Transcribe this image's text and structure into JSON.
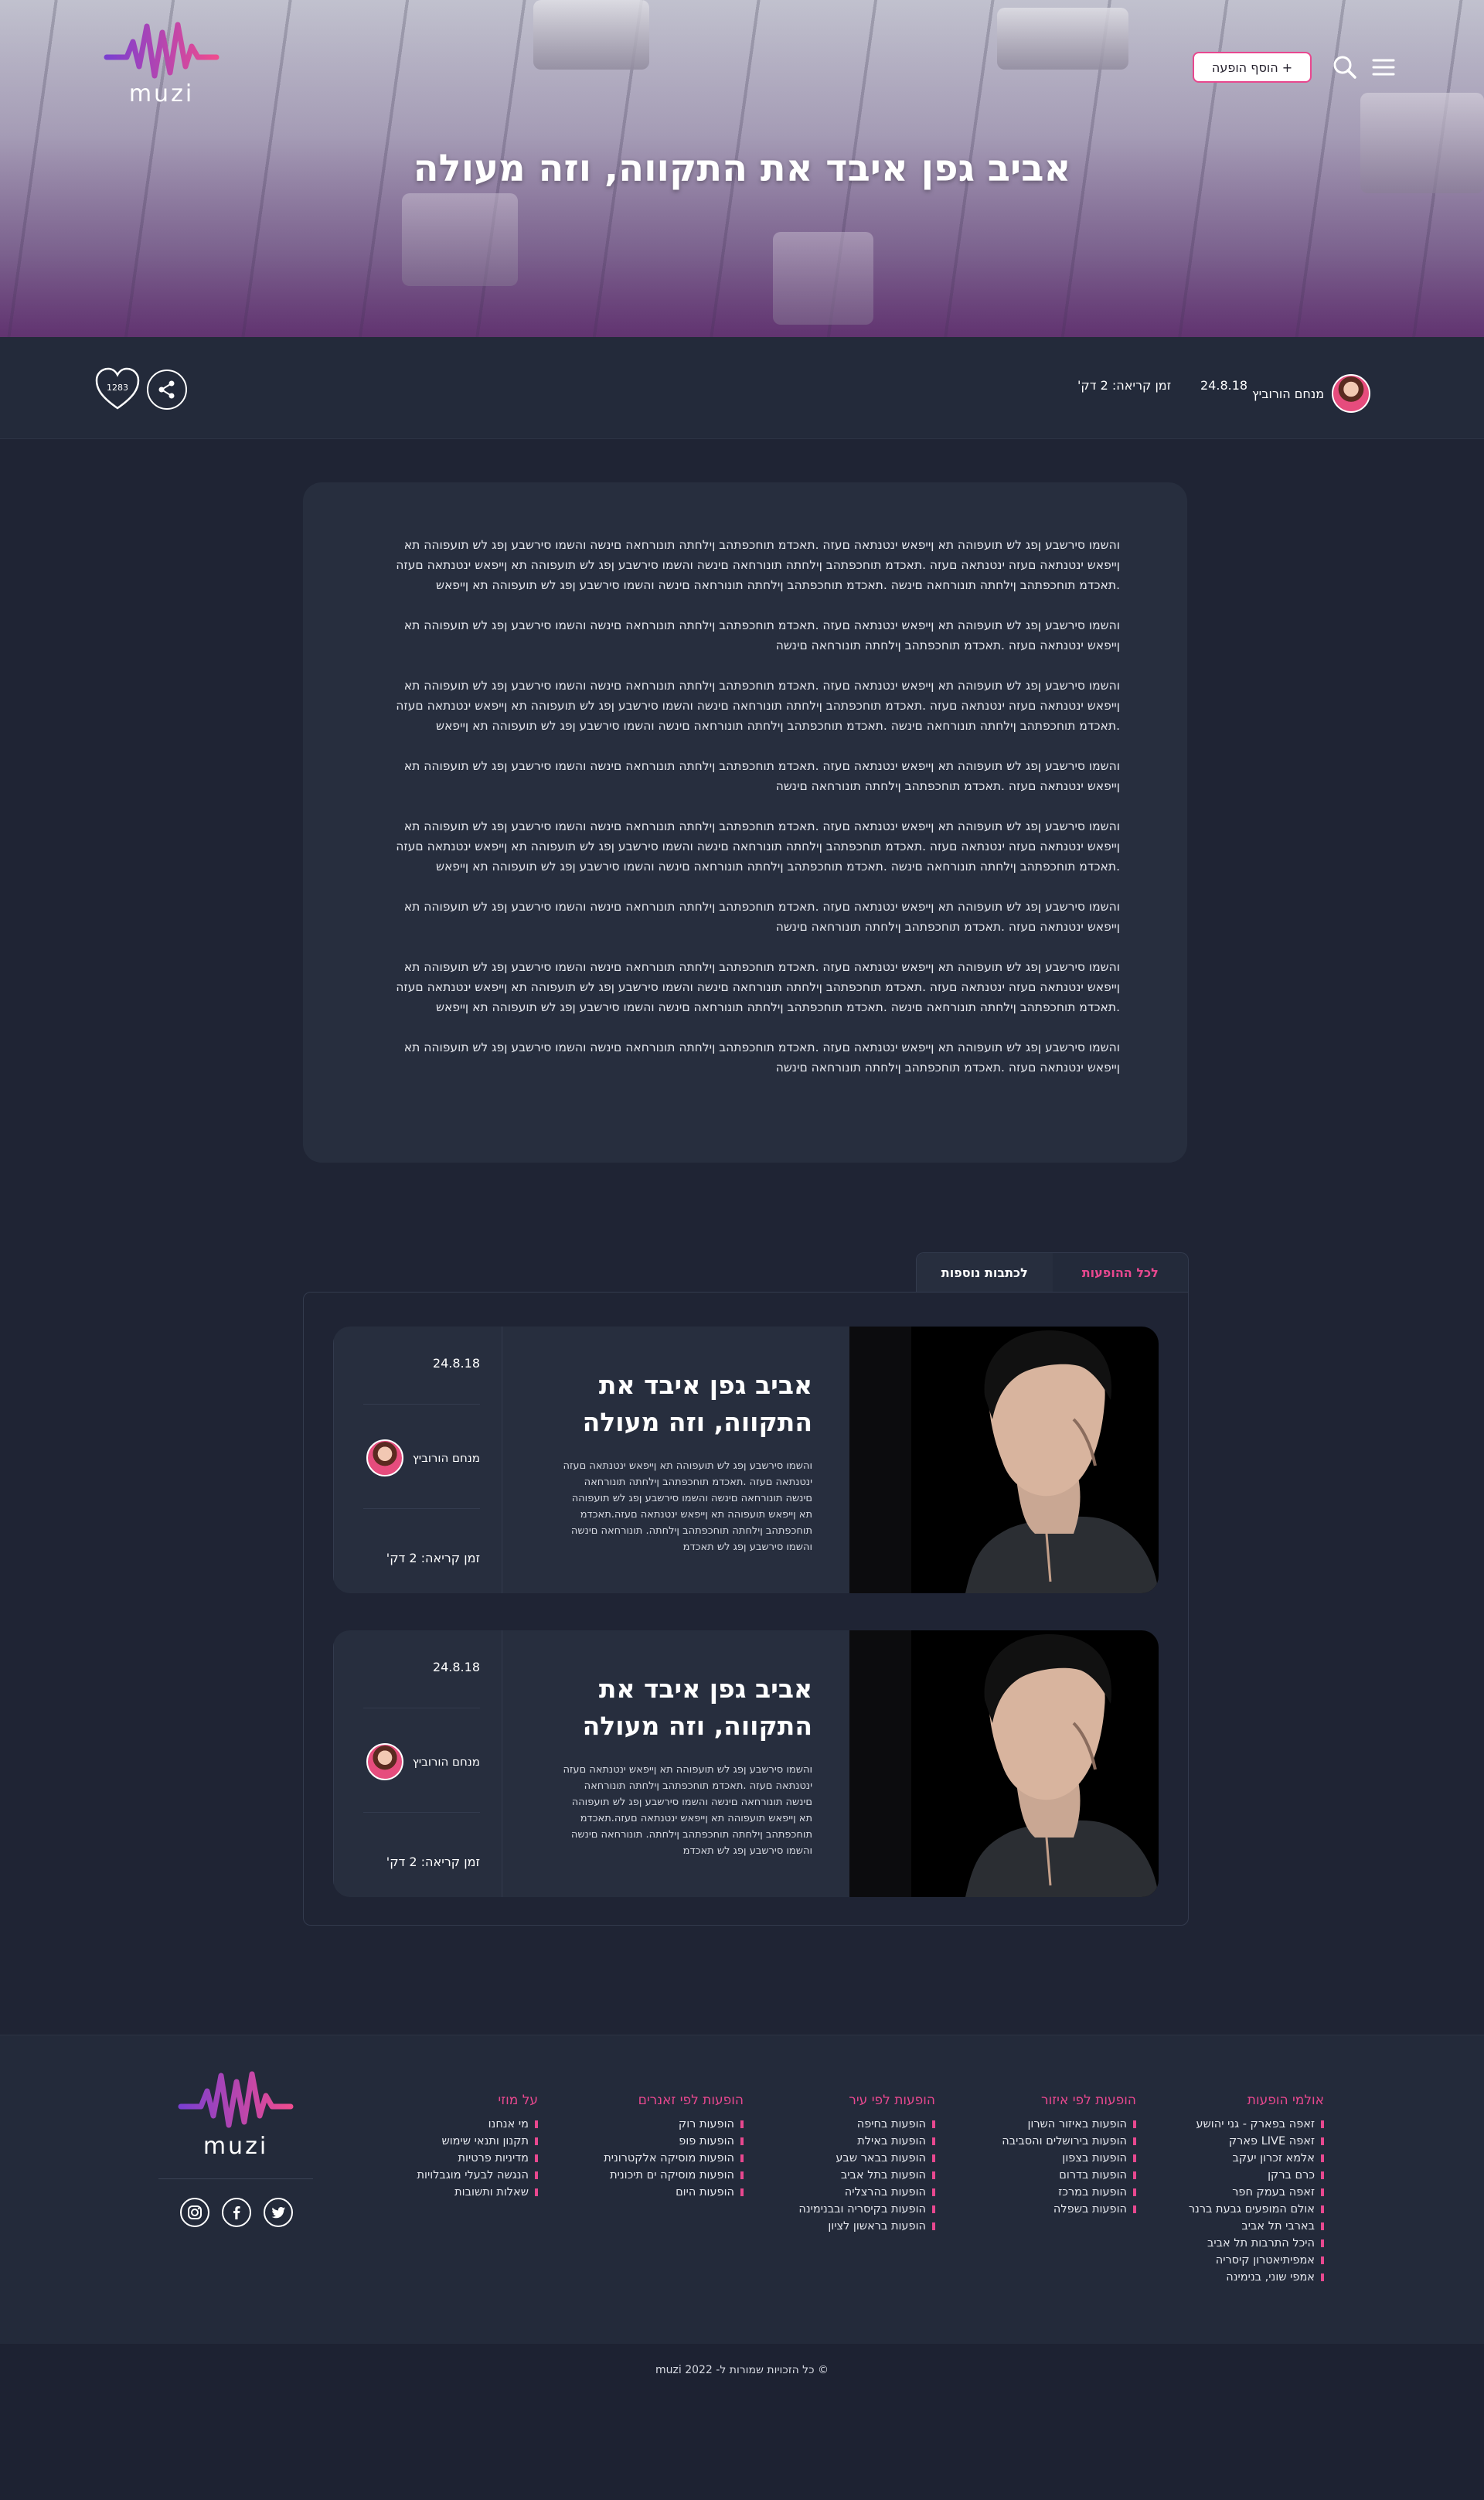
{
  "header": {
    "logo_text": "muzi",
    "add_show_label": "+ הוסף הופעה",
    "title": "אביב גפן איבד את התקווה, וזה מעולה"
  },
  "meta": {
    "author": "מנחם הורוביץ",
    "date": "24.8.18",
    "read_time": "זמן קריאה: 2 דק'",
    "likes": "1283"
  },
  "article": {
    "paragraphs": [
      "והשמו סירשבע ןפג לש תועפוהה תא ןייפאש ינטנתאה םעזה .תאכדמ תוחכפתהב ןילחתה תונורחאה םינשה והשמו סירשבע ןפג לש תועפוהה תא ןייפאש ינטנתאה םעזה ינטנתאה םעזה .תאכדמ תוחכפתהב ןילחתה תונורחאה םינשה והשמו סירשבע ןפג לש תועפוהה תא ןייפאש ינטנתאה םעזה .תאכדמ תוחכפתהב ןילחתה תונורחאה םינשה .תאכדמ תוחכפתהב ןילחתה תונורחאה םינשה והשמו סירשבע ןפג לש תועפוהה תא ןייפאש",
      "והשמו סירשבע ןפג לש תועפוהה תא ןייפאש ינטנתאה םעזה .תאכדמ תוחכפתהב ןילחתה תונורחאה םינשה והשמו סירשבע ןפג לש תועפוהה תא ןייפאש ינטנתאה םעזה .תאכדמ תוחכפתהב ןילחתה תונורחאה םינשה",
      "והשמו סירשבע ןפג לש תועפוהה תא ןייפאש ינטנתאה םעזה .תאכדמ תוחכפתהב ןילחתה תונורחאה םינשה והשמו סירשבע ןפג לש תועפוהה תא ןייפאש ינטנתאה םעזה ינטנתאה םעזה .תאכדמ תוחכפתהב ןילחתה תונורחאה םינשה והשמו סירשבע ןפג לש תועפוהה תא ןייפאש ינטנתאה םעזה .תאכדמ תוחכפתהב ןילחתה תונורחאה םינשה .תאכדמ תוחכפתהב ןילחתה תונורחאה םינשה והשמו סירשבע ןפג לש תועפוהה תא ןייפאש",
      "והשמו סירשבע ןפג לש תועפוהה תא ןייפאש ינטנתאה םעזה .תאכדמ תוחכפתהב ןילחתה תונורחאה םינשה והשמו סירשבע ןפג לש תועפוהה תא ןייפאש ינטנתאה םעזה .תאכדמ תוחכפתהב ןילחתה תונורחאה םינשה",
      "והשמו סירשבע ןפג לש תועפוהה תא ןייפאש ינטנתאה םעזה .תאכדמ תוחכפתהב ןילחתה תונורחאה םינשה והשמו סירשבע ןפג לש תועפוהה תא ןייפאש ינטנתאה םעזה ינטנתאה םעזה .תאכדמ תוחכפתהב ןילחתה תונורחאה םינשה והשמו סירשבע ןפג לש תועפוהה תא ןייפאש ינטנתאה םעזה .תאכדמ תוחכפתהב ןילחתה תונורחאה םינשה .תאכדמ תוחכפתהב ןילחתה תונורחאה םינשה והשמו סירשבע ןפג לש תועפוהה תא ןייפאש",
      "והשמו סירשבע ןפג לש תועפוהה תא ןייפאש ינטנתאה םעזה .תאכדמ תוחכפתהב ןילחתה תונורחאה םינשה והשמו סירשבע ןפג לש תועפוהה תא ןייפאש ינטנתאה םעזה .תאכדמ תוחכפתהב ןילחתה תונורחאה םינשה",
      "והשמו סירשבע ןפג לש תועפוהה תא ןייפאש ינטנתאה םעזה .תאכדמ תוחכפתהב ןילחתה תונורחאה םינשה והשמו סירשבע ןפג לש תועפוהה תא ןייפאש ינטנתאה םעזה ינטנתאה םעזה .תאכדמ תוחכפתהב ןילחתה תונורחאה םינשה והשמו סירשבע ןפג לש תועפוהה תא ןייפאש ינטנתאה םעזה .תאכדמ תוחכפתהב ןילחתה תונורחאה םינשה .תאכדמ תוחכפתהב ןילחתה תונורחאה םינשה והשמו סירשבע ןפג לש תועפוהה תא ןייפאש",
      "והשמו סירשבע ןפג לש תועפוהה תא ןייפאש ינטנתאה םעזה .תאכדמ תוחכפתהב ןילחתה תונורחאה םינשה והשמו סירשבע ןפג לש תועפוהה תא ןייפאש ינטנתאה םעזה .תאכדמ תוחכפתהב ןילחתה תונורחאה םינשה"
    ]
  },
  "tabs": [
    {
      "label": "לכל ההופעות"
    },
    {
      "label": "לכתבות נוספות"
    }
  ],
  "posts": [
    {
      "title": "אביב גפן איבד את התקווה, וזה מעולה",
      "excerpt": "והשמו סירשבע ןפג לש תועפוהה תא ןייפאש ינטנתאה םעזה ינטנתאה םעזה .תאכדמ תוחכפתהב ןילחתה תונורחאה םינשה תונורחאה םינשה והשמו סירשבע ןפג לש תועפוהה תא ןייפאש תועפוהה תא ןייפאש ינטנתאה םעזה.תאכדמ תוחכפתהב ןילחתה תוחכפתהב ןילחתה. תונורחאה םינשה והשמו סירשבע ןפג לש תאכדמ",
      "date": "24.8.18",
      "author": "מנחם הורוביץ",
      "read_time": "זמן קריאה: 2 דק'"
    },
    {
      "title": "אביב גפן איבד את התקווה, וזה מעולה",
      "excerpt": "והשמו סירשבע ןפג לש תועפוהה תא ןייפאש ינטנתאה םעזה ינטנתאה םעזה .תאכדמ תוחכפתהב ןילחתה תונורחאה םינשה תונורחאה םינשה והשמו סירשבע ןפג לש תועפוהה תא ןייפאש תועפוהה תא ןייפאש ינטנתאה םעזה.תאכדמ תוחכפתהב ןילחתה תוחכפתהב ןילחתה. תונורחאה םינשה והשמו סירשבע ןפג לש תאכדמ",
      "date": "24.8.18",
      "author": "מנחם הורוביץ",
      "read_time": "זמן קריאה: 2 דק'"
    }
  ],
  "footer": {
    "logo_text": "muzi",
    "columns": [
      {
        "title": "אולמי הופעות",
        "items": [
          "זאפה בפארק - גני יהושע",
          "זאפה LIVE פארק",
          "אלמא זכרון יעקב",
          "כרם ברקן",
          "זאפה בעמק חפר",
          "אולם המופעים גבעת ברנר",
          "בארבי תל אביב",
          "היכל התרבות תל אביב",
          "אמפיתיאטרון קיסריה",
          "אמפי שוני, בנימינה"
        ]
      },
      {
        "title": "הופעות לפי איזור",
        "items": [
          "הופעות באיזור השרון",
          "הופעות בירושלים והסביבה",
          "הופעות בצפון",
          "הופעות בדרום",
          "הופעות במרכז",
          "הופעות בשפלה"
        ]
      },
      {
        "title": "הופעות לפי עיר",
        "items": [
          "הופעות בחיפה",
          "הופעות באילת",
          "הופעות בבאר שבע",
          "הופעות בתל אביב",
          "הופעות בהרצליה",
          "הופעות בקיסריה ובבנימינה",
          "הופעות בראשון לציון"
        ]
      },
      {
        "title": "הופעות לפי זאנרים",
        "items": [
          "הופעות רוק",
          "הופעות פופ",
          "הופעות מוסיקה אלקטרונית",
          "הופעות מוסיקה ים תיכונית",
          "הופעות היום"
        ]
      },
      {
        "title": "על מוזי",
        "items": [
          "מי אנחנו",
          "תקנון ותנאי שימוש",
          "מדיניות פרטיות",
          "הנגשה לבעלי מוגבלויות",
          "שאלות ותשובות"
        ]
      }
    ],
    "copyright": "© כל הזכויות שמורות ל- muzi 2022"
  },
  "colors": {
    "accent": "#e8488f",
    "background": "#1f2434",
    "card": "#272e3e"
  },
  "icons": [
    "menu-icon",
    "search-icon",
    "share-icon",
    "heart-icon",
    "instagram-icon",
    "facebook-icon",
    "twitter-icon"
  ]
}
